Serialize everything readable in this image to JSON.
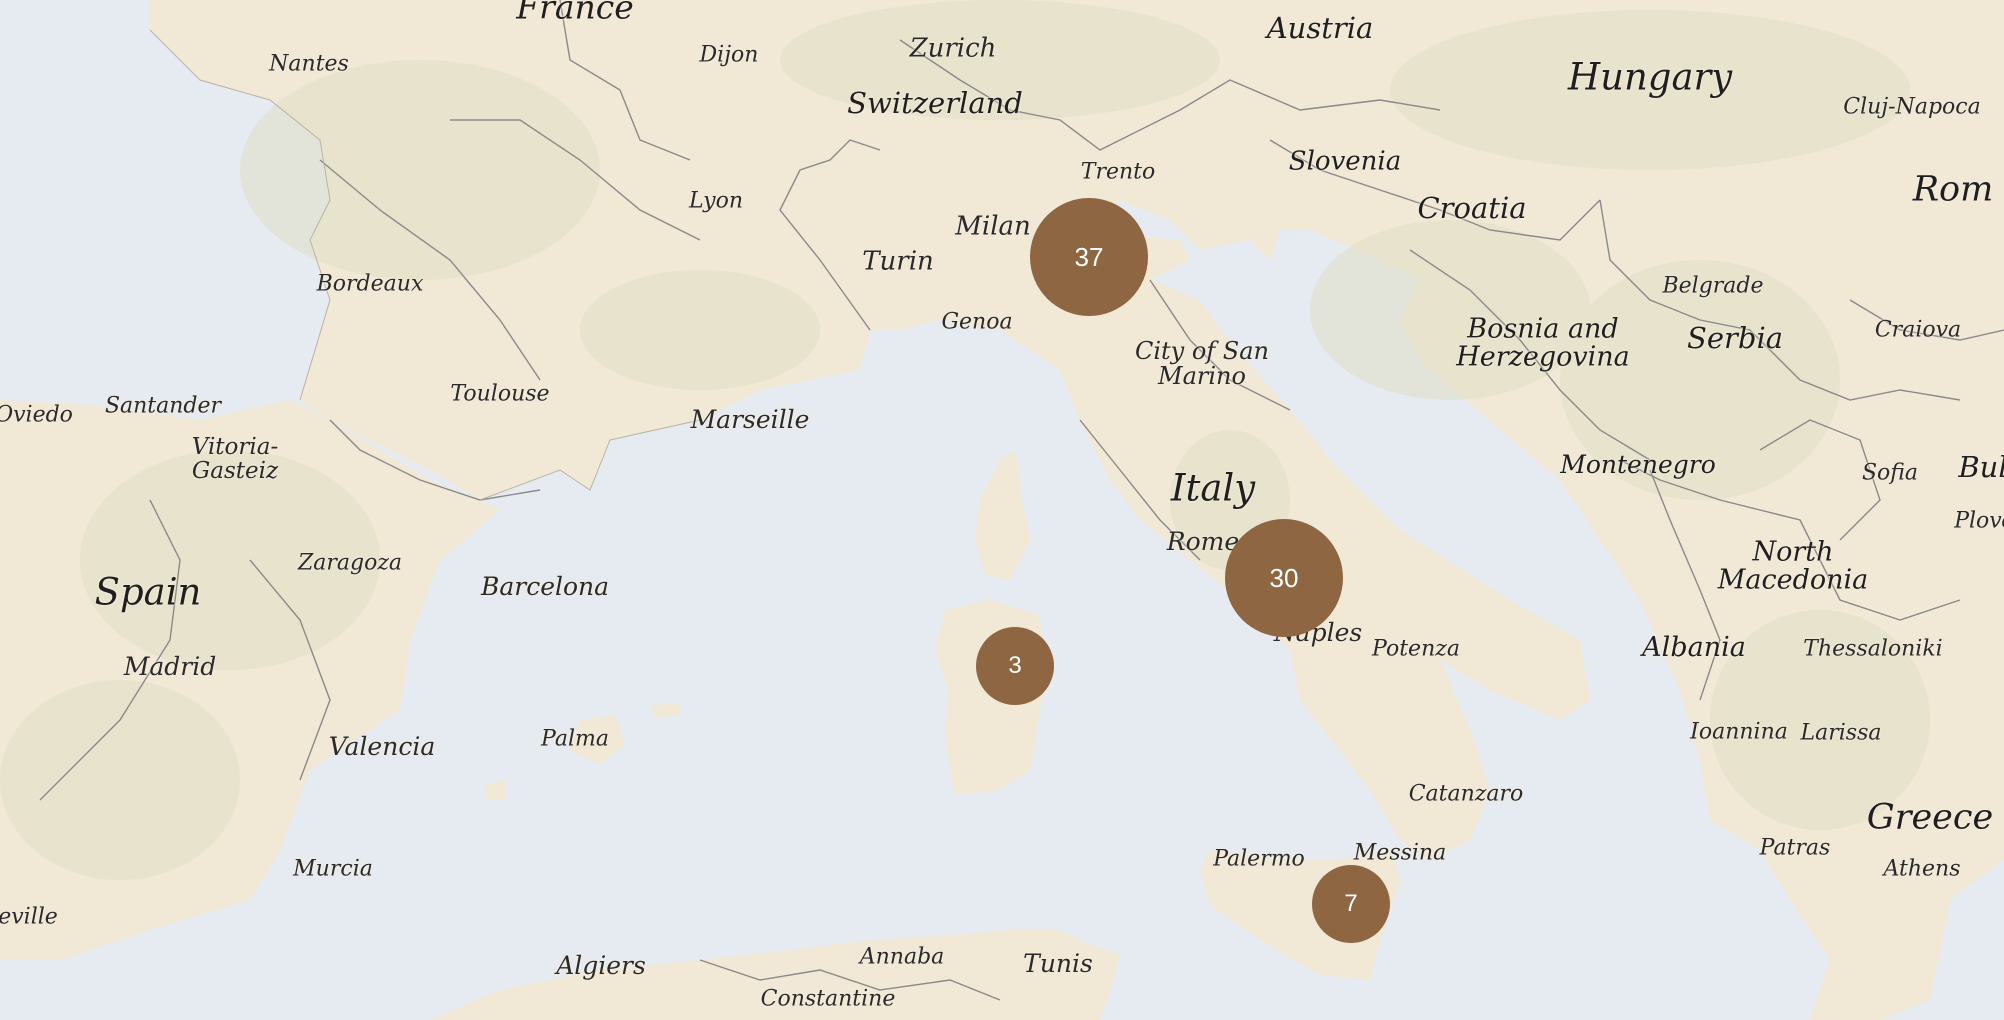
{
  "colors": {
    "sea": "#e6ebf1",
    "land": "#f1e8d6",
    "land_green": "#dfdfc4",
    "border": "#8a8a8a",
    "cluster": "#8e6642",
    "cluster_text": "#ffffff"
  },
  "countries": {
    "france": "France",
    "austria": "Austria",
    "hungary": "Hungary",
    "switzerland": "Switzerland",
    "slovenia": "Slovenia",
    "croatia": "Croatia",
    "romania": "Rom",
    "bosnia": "Bosnia and\nHerzegovina",
    "serbia": "Serbia",
    "montenegro": "Montenegro",
    "bulgaria": "Bul",
    "north_macedonia": "North\nMacedonia",
    "albania": "Albania",
    "greece": "Greece",
    "italy": "Italy",
    "spain": "Spain"
  },
  "cities": {
    "nantes": "Nantes",
    "dijon": "Dijon",
    "zurich": "Zurich",
    "cluj": "Cluj-Napoca",
    "trento": "Trento",
    "lyon": "Lyon",
    "milan": "Milan",
    "turin": "Turin",
    "bordeaux": "Bordeaux",
    "belgrade": "Belgrade",
    "craiova": "Craiova",
    "genoa": "Genoa",
    "san_marino": "City of San\nMarino",
    "toulouse": "Toulouse",
    "santander": "Santander",
    "oviedo": "Oviedo",
    "marseille": "Marseille",
    "vitoria": "Vitoria-\nGasteiz",
    "sofia": "Sofia",
    "plovdiv": "Plovd",
    "rome": "Rome",
    "zaragoza": "Zaragoza",
    "barcelona": "Barcelona",
    "naples": "Naples",
    "potenza": "Potenza",
    "thessaloniki": "Thessaloniki",
    "madrid": "Madrid",
    "ioannina": "Ioannina",
    "larissa": "Larissa",
    "valencia": "Valencia",
    "palma": "Palma",
    "catanzaro": "Catanzaro",
    "palermo": "Palermo",
    "messina": "Messina",
    "patras": "Patras",
    "athens": "Athens",
    "murcia": "Murcia",
    "seville": "eville",
    "algiers": "Algiers",
    "annaba": "Annaba",
    "tunis": "Tunis",
    "constantine": "Constantine"
  },
  "clusters": [
    {
      "id": "north-italy",
      "count": "37"
    },
    {
      "id": "rome-naples",
      "count": "30"
    },
    {
      "id": "sardinia",
      "count": "3"
    },
    {
      "id": "sicily",
      "count": "7"
    }
  ]
}
